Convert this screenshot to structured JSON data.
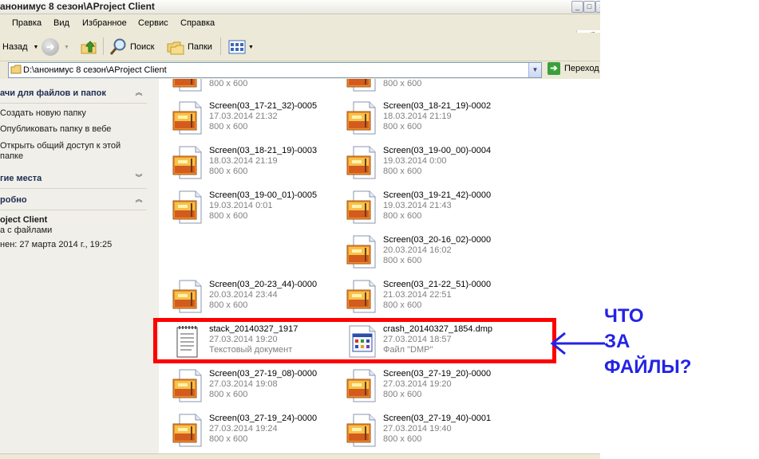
{
  "window": {
    "title": "анонимус 8 сезон\\AProject Client",
    "controls": [
      "_",
      "□",
      "×"
    ]
  },
  "menu": [
    "Правка",
    "Вид",
    "Избранное",
    "Сервис",
    "Справка"
  ],
  "toolbar": {
    "back_label": "Назад",
    "search_label": "Поиск",
    "folders_label": "Папки"
  },
  "address": {
    "path": "D:\\анонимус 8 сезон\\AProject Client",
    "go_label": "Переход"
  },
  "sidebar": {
    "tasks_title": "ачи для файлов и папок",
    "tasks_links": [
      "Создать новую папку",
      "Опубликовать папку в вебе",
      "Открыть общий доступ к этой",
      "папке"
    ],
    "places_title": "гие места",
    "details_title": "робно",
    "details_name": "oject Client",
    "details_type": "а с файлами",
    "details_modified": "нен: 27 марта 2014 г., 19:25"
  },
  "files": {
    "top_partial": [
      "800 x 600",
      "800 x 600"
    ],
    "items": [
      {
        "name": "Screen(03_17-21_32)-0005",
        "line2": "17.03.2014 21:32",
        "line3": "800 x 600",
        "icon": "image-file-icon"
      },
      {
        "name": "Screen(03_18-21_19)-0002",
        "line2": "18.03.2014 21:19",
        "line3": "800 x 600",
        "icon": "image-file-icon"
      },
      {
        "name": "Screen(03_18-21_19)-0003",
        "line2": "18.03.2014 21:19",
        "line3": "800 x 600",
        "icon": "image-file-icon"
      },
      {
        "name": "Screen(03_19-00_00)-0004",
        "line2": "19.03.2014 0:00",
        "line3": "800 x 600",
        "icon": "image-file-icon"
      },
      {
        "name": "Screen(03_19-00_01)-0005",
        "line2": "19.03.2014 0:01",
        "line3": "800 x 600",
        "icon": "image-file-icon"
      },
      {
        "name": "Screen(03_19-21_42)-0000",
        "line2": "19.03.2014 21:43",
        "line3": "800 x 600",
        "icon": "image-file-icon"
      },
      {
        "name": "Screen(03_20-16_02)-0000",
        "line2": "20.03.2014 16:02",
        "line3": "800 x 600",
        "icon": "image-file-icon"
      },
      {
        "name": "Screen(03_20-23_44)-0000",
        "line2": "20.03.2014 23:44",
        "line3": "800 x 600",
        "icon": "image-file-icon"
      },
      {
        "name": "Screen(03_21-22_51)-0000",
        "line2": "21.03.2014 22:51",
        "line3": "800 x 600",
        "icon": "image-file-icon"
      },
      {
        "name": "stack_20140327_1917",
        "line2": "27.03.2014 19:20",
        "line3": "Текстовый документ",
        "icon": "text-file-icon"
      },
      {
        "name": "crash_20140327_1854.dmp",
        "line2": "27.03.2014 18:57",
        "line3": "Файл \"DMP\"",
        "icon": "dmp-file-icon"
      },
      {
        "name": "Screen(03_27-19_08)-0000",
        "line2": "27.03.2014 19:08",
        "line3": "800 x 600",
        "icon": "image-file-icon"
      },
      {
        "name": "Screen(03_27-19_20)-0000",
        "line2": "27.03.2014 19:20",
        "line3": "800 x 600",
        "icon": "image-file-icon"
      },
      {
        "name": "Screen(03_27-19_24)-0000",
        "line2": "27.03.2014 19:24",
        "line3": "800 x 600",
        "icon": "image-file-icon"
      },
      {
        "name": "Screen(03_27-19_40)-0001",
        "line2": "27.03.2014 19:40",
        "line3": "800 x 600",
        "icon": "image-file-icon"
      }
    ]
  },
  "annotation": {
    "lines": [
      "ЧТО",
      "ЗА",
      "ФАЙЛЫ?"
    ],
    "color": "#2323e6",
    "box_color": "#ff0000"
  }
}
